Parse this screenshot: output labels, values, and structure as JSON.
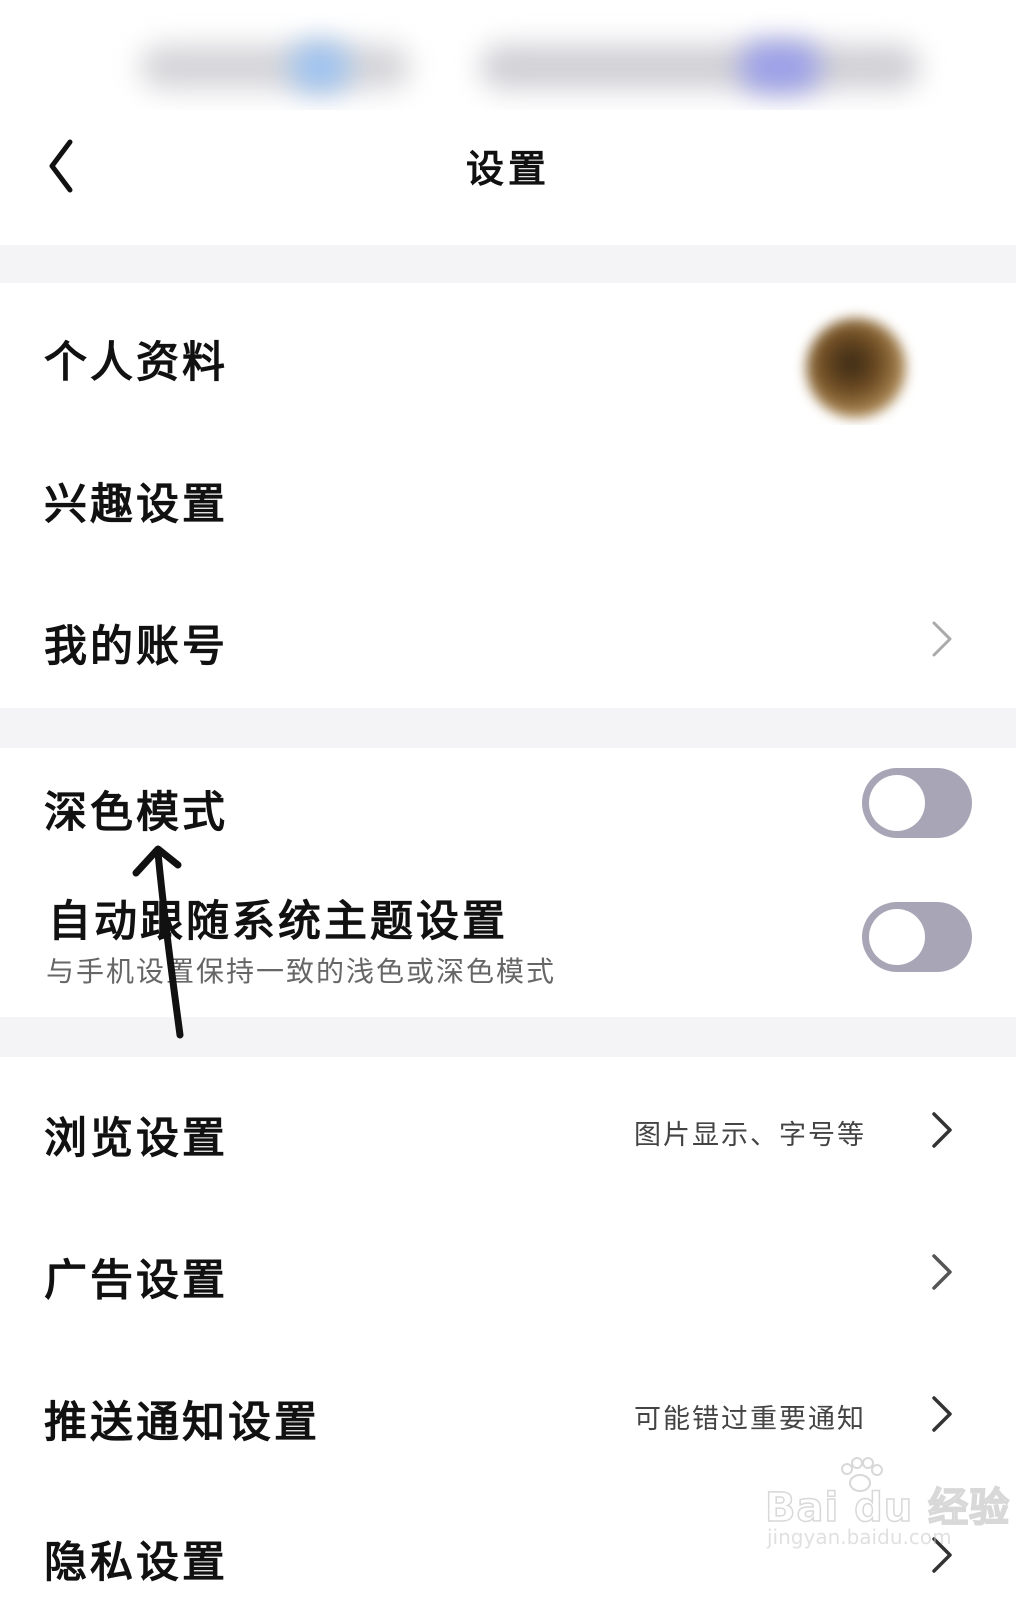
{
  "header": {
    "title": "设置",
    "back_icon": "chevron-left-icon"
  },
  "group1": {
    "profile": {
      "label": "个人资料"
    },
    "interests": {
      "label": "兴趣设置"
    },
    "account": {
      "label": "我的账号"
    }
  },
  "group2": {
    "dark_mode": {
      "label": "深色模式",
      "on": false
    },
    "follow_system": {
      "label": "自动跟随系统主题设置",
      "subtitle": "与手机设置保持一致的浅色或深色模式",
      "on": false
    }
  },
  "group3": {
    "browsing": {
      "label": "浏览设置",
      "hint": "图片显示、字号等"
    },
    "ads": {
      "label": "广告设置"
    },
    "push": {
      "label": "推送通知设置",
      "hint": "可能错过重要通知"
    },
    "privacy": {
      "label": "隐私设置"
    }
  },
  "watermark": {
    "logo": "Bai du 经验",
    "url": "jingyan.baidu.com"
  },
  "colors": {
    "toggle_off": "#a8a6b6",
    "section_gap": "#f4f4f7",
    "annotation": "#111111"
  }
}
